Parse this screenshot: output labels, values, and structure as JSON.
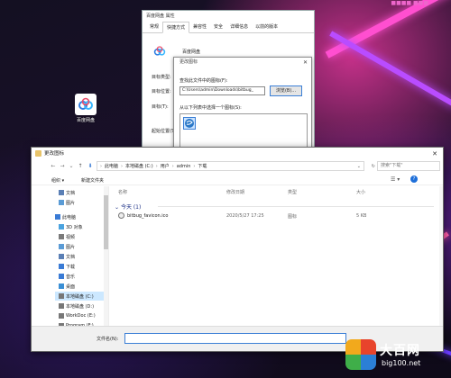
{
  "desktop": {
    "icon_label": "百度网盘",
    "top_text": "■■■■ ■■■"
  },
  "properties_window": {
    "title": "百度网盘 属性",
    "tabs": [
      "常规",
      "快捷方式",
      "兼容性",
      "安全",
      "详细信息",
      "以前的版本"
    ],
    "app_name": "百度网盘",
    "labels": [
      "目标类型:",
      "目标位置:",
      "目标(T):",
      "起始位置(S):"
    ]
  },
  "change_icon_dialog": {
    "title": "更改图标",
    "find_label": "查找此文件中的图标(F):",
    "path_value": "C:\\Users\\admin\\Downloads\\bitbug_",
    "browse_button": "浏览(B)...",
    "select_label": "从以下列表中选择一个图标(S):"
  },
  "file_dialog": {
    "title": "更改图标",
    "breadcrumb": [
      "此电脑",
      "本地磁盘 (C:)",
      "用户",
      "admin",
      "下载"
    ],
    "search_placeholder": "搜索\"下载\"",
    "organize": "组织 ▾",
    "new_folder": "新建文件夹",
    "sidebar": [
      {
        "label": "文档",
        "icon": "document-icon",
        "color": "#5a7fb5"
      },
      {
        "label": "图片",
        "icon": "picture-icon",
        "color": "#5a9bd5"
      },
      {
        "label": "此电脑",
        "icon": "computer-icon",
        "color": "#3a7bd5"
      },
      {
        "label": "3D 对象",
        "icon": "cube-icon",
        "color": "#4aa3df"
      },
      {
        "label": "视频",
        "icon": "video-icon",
        "color": "#7a7a7a"
      },
      {
        "label": "图片",
        "icon": "picture-icon",
        "color": "#5a9bd5"
      },
      {
        "label": "文档",
        "icon": "document-icon",
        "color": "#5a7fb5"
      },
      {
        "label": "下载",
        "icon": "download-icon",
        "color": "#3a7bd5"
      },
      {
        "label": "音乐",
        "icon": "music-icon",
        "color": "#3a7bd5"
      },
      {
        "label": "桌面",
        "icon": "desktop-icon",
        "color": "#3a8fd5"
      },
      {
        "label": "本地磁盘 (C:)",
        "icon": "drive-icon",
        "color": "#777777"
      },
      {
        "label": "本地磁盘 (D:)",
        "icon": "drive-icon",
        "color": "#777777"
      },
      {
        "label": "WorkDoc (E:)",
        "icon": "drive-icon",
        "color": "#777777"
      },
      {
        "label": "Program (F:)",
        "icon": "drive-icon",
        "color": "#777777"
      }
    ],
    "columns": [
      "名称",
      "修改日期",
      "类型",
      "大小"
    ],
    "group": "今天 (1)",
    "files": [
      {
        "name": "bitbug_favicon.ico",
        "date": "2020/5/27 17:25",
        "type": "图标",
        "size": "5 KB"
      }
    ],
    "filename_label": "文件名(N):",
    "filename_value": ""
  },
  "watermark": {
    "brand": "大百网",
    "url": "big100.net"
  }
}
